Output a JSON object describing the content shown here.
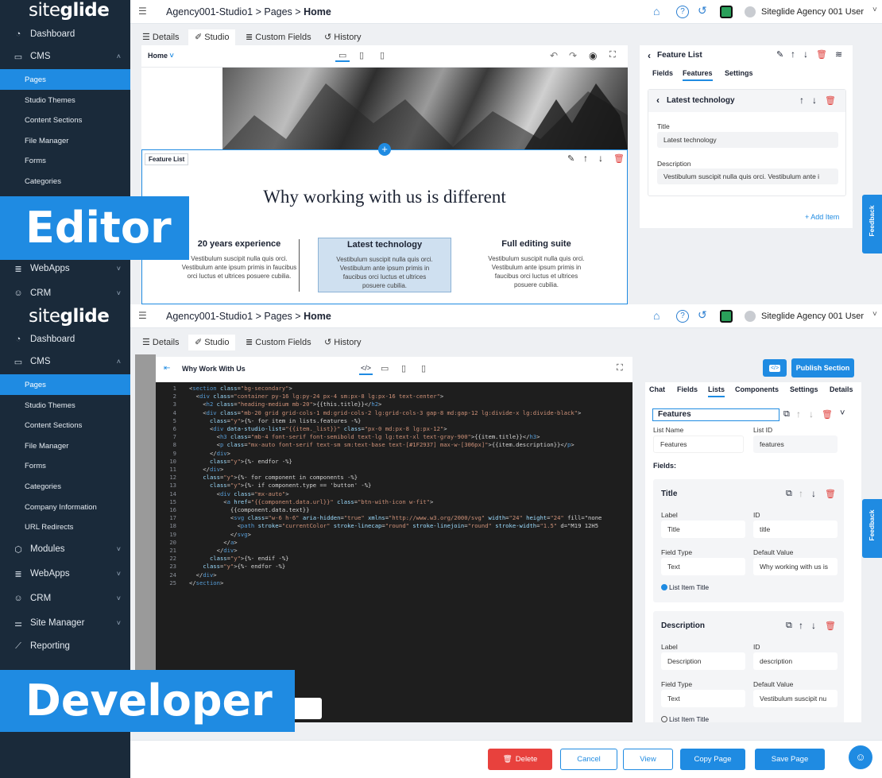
{
  "colors": {
    "accent": "#1f8be2",
    "sidebar": "#1a2a3a",
    "danger": "#e8413d"
  },
  "top": {
    "logo_a": "site",
    "logo_b": "glide",
    "breadcrumb_site": "Agency001-Studio1",
    "breadcrumb_sep1": " > ",
    "breadcrumb_pages": "Pages",
    "breadcrumb_sep2": " > ",
    "breadcrumb_page": "Home",
    "user": "Siteglide Agency 001 User",
    "icons": [
      "home-icon",
      "help-icon",
      "history-icon",
      "siteglide-app-icon",
      "avatar",
      "chevron-down-icon"
    ],
    "sidebar": {
      "dashboard": "Dashboard",
      "cms": "CMS",
      "pages": "Pages",
      "themes": "Studio Themes",
      "sections": "Content Sections",
      "files": "File Manager",
      "forms": "Forms",
      "categories": "Categories",
      "webapps": "WebApps",
      "crm": "CRM"
    },
    "tabs": {
      "details": "Details",
      "studio": "Studio",
      "custom_fields": "Custom Fields",
      "history": "History"
    },
    "page_select": "Home",
    "overlay_label": "Editor",
    "block_label": "Feature List",
    "heading": "Why working with us is different",
    "columns": [
      {
        "title": "20 years experience",
        "text": "Vestibulum suscipit nulla quis orci. Vestibulum ante ipsum primis in faucibus orci luctus et ultrices posuere cubilia."
      },
      {
        "title": "Latest technology",
        "text": "Vestibulum suscipit nulla quis orci. Vestibulum ante ipsum primis in faucibus orci luctus et ultrices posuere cubilia."
      },
      {
        "title": "Full editing suite",
        "text": "Vestibulum suscipit nulla quis orci. Vestibulum ante ipsum primis in faucibus orci luctus et ultrices posuere cubilia."
      }
    ],
    "right": {
      "title": "Feature List",
      "tab_fields": "Fields",
      "tab_features": "Features",
      "tab_settings": "Settings",
      "item_title": "Latest technology",
      "title_label": "Title",
      "title_value": "Latest technology",
      "desc_label": "Description",
      "desc_value": "Vestibulum suscipit nulla quis orci. Vestibulum ante i",
      "add_item": "+ Add Item"
    },
    "feedback": "Feedback"
  },
  "bottom": {
    "logo_a": "site",
    "logo_b": "glide",
    "breadcrumb_site": "Agency001-Studio1",
    "breadcrumb_sep1": " > ",
    "breadcrumb_pages": "Pages",
    "breadcrumb_sep2": " > ",
    "breadcrumb_page": "Home",
    "user": "Siteglide Agency 001 User",
    "sidebar": {
      "dashboard": "Dashboard",
      "cms": "CMS",
      "pages": "Pages",
      "themes": "Studio Themes",
      "sections": "Content Sections",
      "files": "File Manager",
      "forms": "Forms",
      "categories": "Categories",
      "company": "Company Information",
      "redirects": "URL Redirects",
      "modules": "Modules",
      "webapps": "WebApps",
      "crm": "CRM",
      "site_manager": "Site Manager",
      "reporting": "Reporting"
    },
    "tabs": {
      "details": "Details",
      "studio": "Studio",
      "custom_fields": "Custom Fields",
      "history": "History"
    },
    "section_name": "Why Work With Us",
    "overlay_label": "Developer",
    "publish": "Publish Section",
    "right_tabs": [
      "Chat",
      "Fields",
      "Lists",
      "Components",
      "Settings",
      "Details"
    ],
    "list_name_value": "Features",
    "list_name_label": "List Name",
    "list_id_label": "List ID",
    "list_name": "Features",
    "list_id": "features",
    "fields_label": "Fields:",
    "field1": {
      "name": "Title",
      "label_l": "Label",
      "id_l": "ID",
      "label": "Title",
      "id": "title",
      "type_l": "Field Type",
      "default_l": "Default Value",
      "type": "Text",
      "default": "Why working with us is",
      "radio": "List Item Title"
    },
    "field2": {
      "name": "Description",
      "label_l": "Label",
      "id_l": "ID",
      "label": "Description",
      "id": "description",
      "type_l": "Field Type",
      "default_l": "Default Value",
      "type": "Text",
      "default": "Vestibulum suscipit nu",
      "radio": "List Item Title"
    },
    "code": [
      "<section class=\"bg-secondary\">",
      "  <div class=\"container py-16 lg:py-24 px-4 sm:px-8 lg:px-16 text-center\">",
      "    <h2 class=\"heading-medium mb-20\">{{this.title}}</h2>",
      "    <div class=\"mb-20 grid grid-cols-1 md:grid-cols-2 lg:grid-cols-3 gap-8 md:gap-12 lg:divide-x lg:divide-black\">",
      "      {%- for item in lists.features -%}",
      "      <div data-studio-list=\"{{item._list}}\" class=\"px-0 md:px-8 lg:px-12\">",
      "        <h3 class=\"mb-4 font-serif font-semibold text-lg lg:text-xl text-gray-900\">{{item.title}}</h3>",
      "        <p class=\"mx-auto font-serif text-sm sm:text-base text-[#1F2937] max-w-[306px]\">{{item.description}}</p>",
      "      </div>",
      "      {%- endfor -%}",
      "    </div>",
      "    {%- for component in components -%}",
      "      {%- if component.type == 'button' -%}",
      "        <div class=\"mx-auto\">",
      "          <a href=\"{{component.data.url}}\" class=\"btn-with-icon w-fit\">",
      "            {{component.data.text}}",
      "            <svg class=\"w-6 h-6\" aria-hidden=\"true\" xmlns=\"http://www.w3.org/2000/svg\" width=\"24\" height=\"24\" fill=\"none",
      "              <path stroke=\"currentColor\" stroke-linecap=\"round\" stroke-linejoin=\"round\" stroke-width=\"1.5\" d=\"M19 12H5",
      "            </svg>",
      "          </a>",
      "        </div>",
      "      {%- endif -%}",
      "    {%- endfor -%}",
      "  </div>",
      "</section>"
    ],
    "buttons": {
      "delete": "Delete",
      "cancel": "Cancel",
      "view": "View",
      "copy": "Copy Page",
      "save": "Save Page"
    },
    "feedback": "Feedback"
  }
}
